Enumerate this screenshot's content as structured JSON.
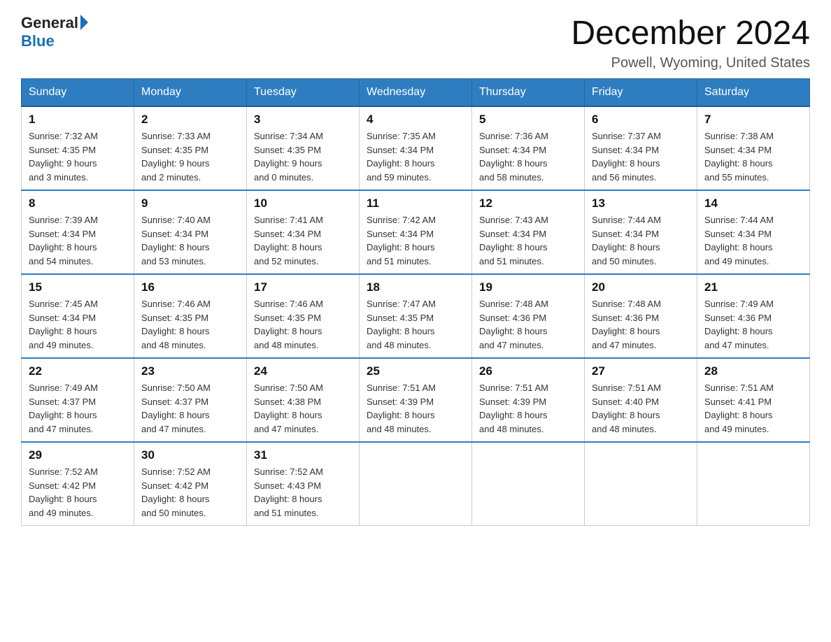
{
  "logo": {
    "general": "General",
    "blue": "Blue"
  },
  "header": {
    "title": "December 2024",
    "subtitle": "Powell, Wyoming, United States"
  },
  "weekdays": [
    "Sunday",
    "Monday",
    "Tuesday",
    "Wednesday",
    "Thursday",
    "Friday",
    "Saturday"
  ],
  "weeks": [
    [
      {
        "day": "1",
        "sunrise": "7:32 AM",
        "sunset": "4:35 PM",
        "daylight": "9 hours and 3 minutes."
      },
      {
        "day": "2",
        "sunrise": "7:33 AM",
        "sunset": "4:35 PM",
        "daylight": "9 hours and 2 minutes."
      },
      {
        "day": "3",
        "sunrise": "7:34 AM",
        "sunset": "4:35 PM",
        "daylight": "9 hours and 0 minutes."
      },
      {
        "day": "4",
        "sunrise": "7:35 AM",
        "sunset": "4:34 PM",
        "daylight": "8 hours and 59 minutes."
      },
      {
        "day": "5",
        "sunrise": "7:36 AM",
        "sunset": "4:34 PM",
        "daylight": "8 hours and 58 minutes."
      },
      {
        "day": "6",
        "sunrise": "7:37 AM",
        "sunset": "4:34 PM",
        "daylight": "8 hours and 56 minutes."
      },
      {
        "day": "7",
        "sunrise": "7:38 AM",
        "sunset": "4:34 PM",
        "daylight": "8 hours and 55 minutes."
      }
    ],
    [
      {
        "day": "8",
        "sunrise": "7:39 AM",
        "sunset": "4:34 PM",
        "daylight": "8 hours and 54 minutes."
      },
      {
        "day": "9",
        "sunrise": "7:40 AM",
        "sunset": "4:34 PM",
        "daylight": "8 hours and 53 minutes."
      },
      {
        "day": "10",
        "sunrise": "7:41 AM",
        "sunset": "4:34 PM",
        "daylight": "8 hours and 52 minutes."
      },
      {
        "day": "11",
        "sunrise": "7:42 AM",
        "sunset": "4:34 PM",
        "daylight": "8 hours and 51 minutes."
      },
      {
        "day": "12",
        "sunrise": "7:43 AM",
        "sunset": "4:34 PM",
        "daylight": "8 hours and 51 minutes."
      },
      {
        "day": "13",
        "sunrise": "7:44 AM",
        "sunset": "4:34 PM",
        "daylight": "8 hours and 50 minutes."
      },
      {
        "day": "14",
        "sunrise": "7:44 AM",
        "sunset": "4:34 PM",
        "daylight": "8 hours and 49 minutes."
      }
    ],
    [
      {
        "day": "15",
        "sunrise": "7:45 AM",
        "sunset": "4:34 PM",
        "daylight": "8 hours and 49 minutes."
      },
      {
        "day": "16",
        "sunrise": "7:46 AM",
        "sunset": "4:35 PM",
        "daylight": "8 hours and 48 minutes."
      },
      {
        "day": "17",
        "sunrise": "7:46 AM",
        "sunset": "4:35 PM",
        "daylight": "8 hours and 48 minutes."
      },
      {
        "day": "18",
        "sunrise": "7:47 AM",
        "sunset": "4:35 PM",
        "daylight": "8 hours and 48 minutes."
      },
      {
        "day": "19",
        "sunrise": "7:48 AM",
        "sunset": "4:36 PM",
        "daylight": "8 hours and 47 minutes."
      },
      {
        "day": "20",
        "sunrise": "7:48 AM",
        "sunset": "4:36 PM",
        "daylight": "8 hours and 47 minutes."
      },
      {
        "day": "21",
        "sunrise": "7:49 AM",
        "sunset": "4:36 PM",
        "daylight": "8 hours and 47 minutes."
      }
    ],
    [
      {
        "day": "22",
        "sunrise": "7:49 AM",
        "sunset": "4:37 PM",
        "daylight": "8 hours and 47 minutes."
      },
      {
        "day": "23",
        "sunrise": "7:50 AM",
        "sunset": "4:37 PM",
        "daylight": "8 hours and 47 minutes."
      },
      {
        "day": "24",
        "sunrise": "7:50 AM",
        "sunset": "4:38 PM",
        "daylight": "8 hours and 47 minutes."
      },
      {
        "day": "25",
        "sunrise": "7:51 AM",
        "sunset": "4:39 PM",
        "daylight": "8 hours and 48 minutes."
      },
      {
        "day": "26",
        "sunrise": "7:51 AM",
        "sunset": "4:39 PM",
        "daylight": "8 hours and 48 minutes."
      },
      {
        "day": "27",
        "sunrise": "7:51 AM",
        "sunset": "4:40 PM",
        "daylight": "8 hours and 48 minutes."
      },
      {
        "day": "28",
        "sunrise": "7:51 AM",
        "sunset": "4:41 PM",
        "daylight": "8 hours and 49 minutes."
      }
    ],
    [
      {
        "day": "29",
        "sunrise": "7:52 AM",
        "sunset": "4:42 PM",
        "daylight": "8 hours and 49 minutes."
      },
      {
        "day": "30",
        "sunrise": "7:52 AM",
        "sunset": "4:42 PM",
        "daylight": "8 hours and 50 minutes."
      },
      {
        "day": "31",
        "sunrise": "7:52 AM",
        "sunset": "4:43 PM",
        "daylight": "8 hours and 51 minutes."
      },
      null,
      null,
      null,
      null
    ]
  ],
  "labels": {
    "sunrise": "Sunrise:",
    "sunset": "Sunset:",
    "daylight": "Daylight:"
  }
}
